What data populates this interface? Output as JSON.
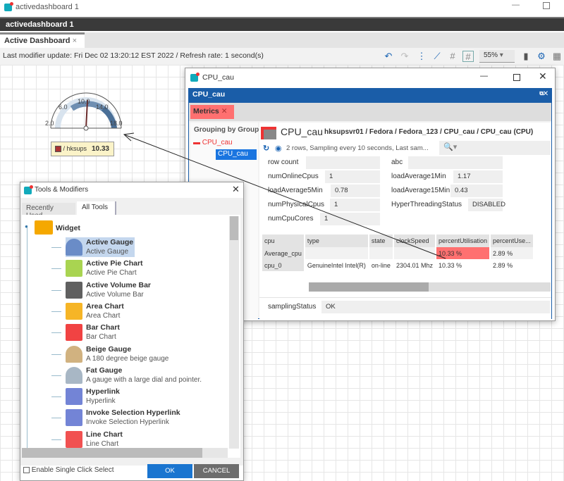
{
  "window": {
    "title": "activedashboard 1",
    "perspective": "activedashboard 1"
  },
  "tab": {
    "label": "Active Dashboard",
    "close": "×"
  },
  "info": {
    "text": "Last modifier update: Fri Dec 02 13:20:12 EST 2022 / Refresh rate: 1 second(s)",
    "zoom": "55%"
  },
  "gauge": {
    "ticks": [
      "2.0",
      "6.0",
      "10.0",
      "14.0",
      "18.0"
    ],
    "label": "/ hksups",
    "value": "10.33",
    "pointer_value": 10.33
  },
  "cpu_window": {
    "title": "CPU_cau",
    "inner_title": "CPU_cau",
    "metrics_tab": "Metrics",
    "grouping": "Grouping by Group",
    "tree": [
      "CPU_cau",
      "CPU_cau"
    ],
    "header_name": "CPU_cau",
    "header_path": "hksupsvr01 / Fedora / Fedora_123 / CPU_cau / CPU_cau (CPU)",
    "status": "2 rows, Sampling every 10 seconds, Last sam...",
    "fields_left": [
      {
        "label": "row count",
        "value": ""
      },
      {
        "label": "numOnlineCpus",
        "value": "1"
      },
      {
        "label": "loadAverage5Min",
        "value": "0.78"
      },
      {
        "label": "numPhysicalCpus",
        "value": "1"
      },
      {
        "label": "numCpuCores",
        "value": "1"
      }
    ],
    "fields_right": [
      {
        "label": "abc",
        "value": ""
      },
      {
        "label": "loadAverage1Min",
        "value": "1.17"
      },
      {
        "label": "loadAverage15Min",
        "value": "0.43"
      },
      {
        "label": "HyperThreadingStatus",
        "value": "DISABLED"
      }
    ],
    "columns": [
      "cpu",
      "type",
      "state",
      "clockSpeed",
      "percentUtilisation",
      "percentUse..."
    ],
    "rows": [
      [
        "Average_cpu",
        "",
        "",
        "",
        "10.33 %",
        "2.89 %"
      ],
      [
        "cpu_0",
        "GenuineIntel Intel(R)",
        "on-line",
        "2304.01 Mhz",
        "10.33 %",
        "2.89 %"
      ]
    ],
    "sampling_label": "samplingStatus",
    "sampling_value": "OK",
    "highlight": "#ff7070"
  },
  "tools": {
    "title": "Tools & Modifiers",
    "tabs": [
      "Recently Used",
      "All Tools"
    ],
    "folder": "Widget",
    "items": [
      {
        "title": "Active Gauge",
        "desc": "Active Gauge"
      },
      {
        "title": "Active Pie Chart",
        "desc": "Active Pie Chart"
      },
      {
        "title": "Active Volume Bar",
        "desc": "Active Volume Bar"
      },
      {
        "title": "Area Chart",
        "desc": "Area Chart"
      },
      {
        "title": "Bar Chart",
        "desc": "Bar Chart"
      },
      {
        "title": "Beige Gauge",
        "desc": "A 180 degree beige gauge"
      },
      {
        "title": "Fat Gauge",
        "desc": "A gauge with a large dial and pointer."
      },
      {
        "title": "Hyperlink",
        "desc": "Hyperlink"
      },
      {
        "title": "Invoke Selection Hyperlink",
        "desc": "Invoke Selection Hyperlink"
      },
      {
        "title": "Line Chart",
        "desc": "Line Chart"
      }
    ],
    "checkbox": "Enable Single Click Select",
    "ok": "OK",
    "cancel": "CANCEL"
  }
}
